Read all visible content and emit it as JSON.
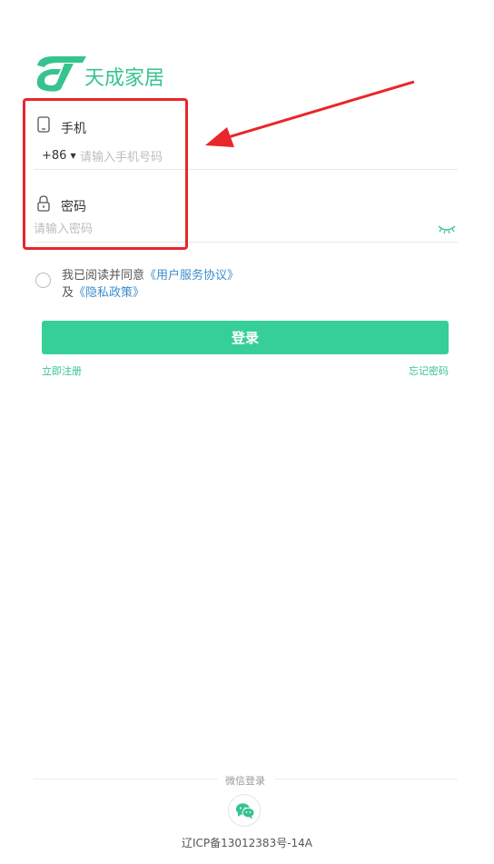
{
  "brand": {
    "name": "天成家居",
    "color": "#36c48e"
  },
  "phone": {
    "icon": "phone-icon",
    "label": "手机",
    "country_code": "+86",
    "placeholder": "请输入手机号码"
  },
  "password": {
    "icon": "lock-icon",
    "label": "密码",
    "placeholder": "请输入密码",
    "visibility_icon": "eye-closed-icon"
  },
  "agreement": {
    "prefix": "我已阅读并同意",
    "terms_link": "《用户服务协议》",
    "and": "及",
    "privacy_link": "《隐私政策》"
  },
  "login": {
    "label": "登录",
    "color": "#36cf98"
  },
  "register_link": "立即注册",
  "forgot_link": "忘记密码",
  "wechat": {
    "label": "微信登录",
    "icon": "wechat-icon"
  },
  "icp": "辽ICP备13012383号-14A",
  "annotation": {
    "box_color": "#e8262b"
  }
}
